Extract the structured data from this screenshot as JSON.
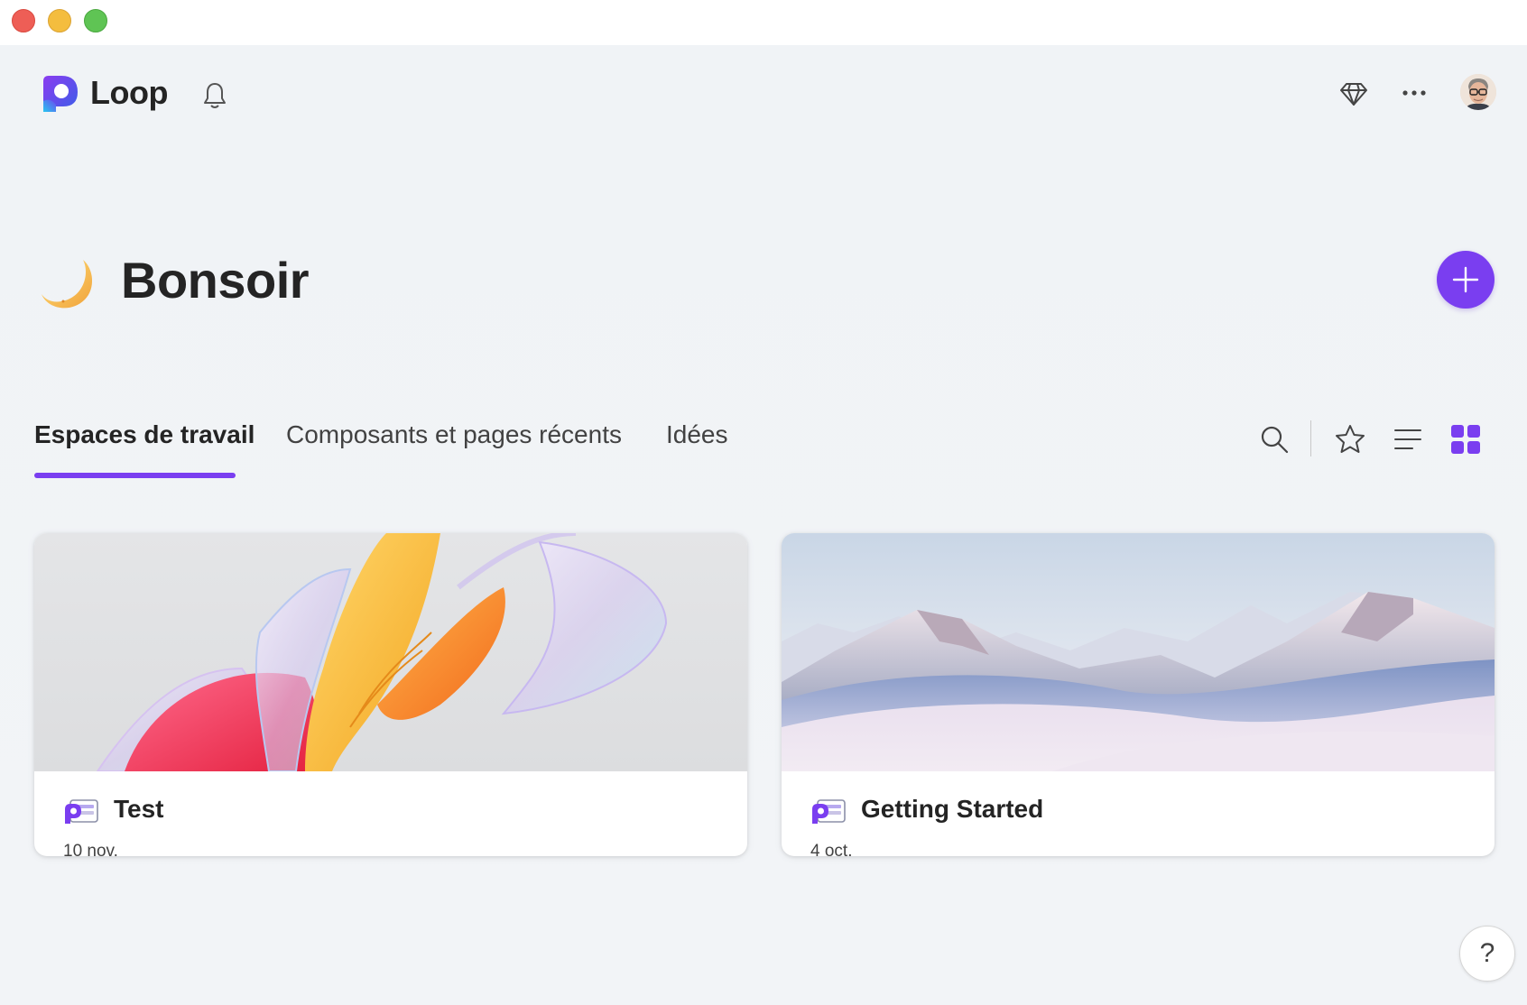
{
  "window": {
    "controls": [
      "close",
      "minimize",
      "maximize"
    ]
  },
  "header": {
    "app_name": "Loop",
    "icons": [
      "loop-logo-icon",
      "bell-icon",
      "diamond-icon",
      "more-icon",
      "avatar"
    ]
  },
  "greeting": {
    "icon": "crescent-moon-icon",
    "text": "Bonsoir"
  },
  "new_button": {
    "icon": "plus-icon"
  },
  "tabs": [
    {
      "label": "Espaces de travail",
      "active": true
    },
    {
      "label": "Composants et pages récents",
      "active": false
    },
    {
      "label": "Idées",
      "active": false
    }
  ],
  "toolbar": {
    "icons": [
      "search-icon",
      "star-icon",
      "list-view-icon",
      "grid-view-icon"
    ],
    "active_view": "grid",
    "accent": "#7a3ef0"
  },
  "workspaces": [
    {
      "title": "Test",
      "date": "10 nov.",
      "cover": "abstract-ribbons"
    },
    {
      "title": "Getting Started",
      "date": "4 oct.",
      "cover": "snowy-mountains"
    }
  ],
  "help": {
    "label": "?"
  }
}
